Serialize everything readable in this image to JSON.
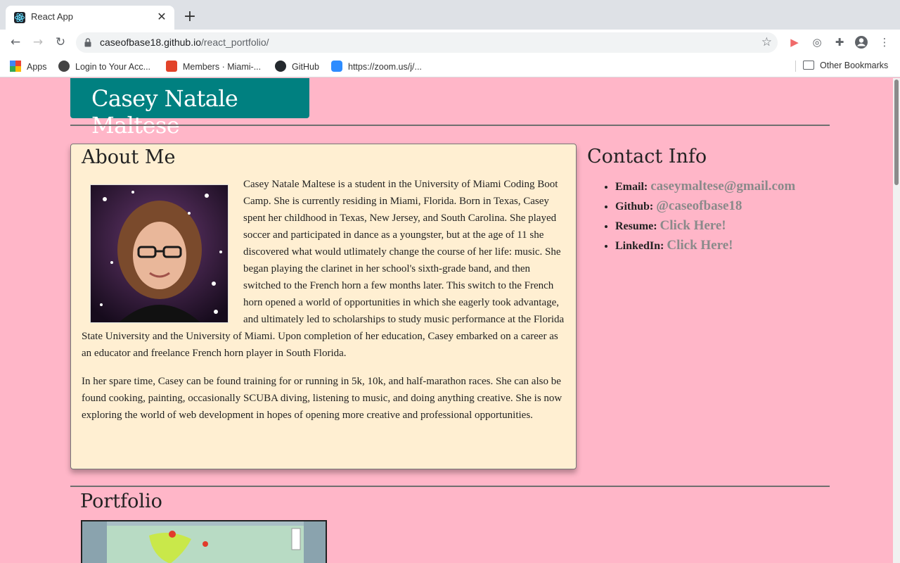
{
  "browser": {
    "tab_title": "React App",
    "tab_close": "✕",
    "new_tab": "+",
    "url_host": "caseofbase18.github.io",
    "url_path": "/react_portfolio/",
    "nav": {
      "back": "←",
      "forward": "→",
      "reload": "↻"
    },
    "star": "☆",
    "bookmarks": [
      {
        "label": "Apps"
      },
      {
        "label": "Login to Your Acc..."
      },
      {
        "label": "Members · Miami-..."
      },
      {
        "label": "GitHub"
      },
      {
        "label": "https://zoom.us/j/..."
      }
    ],
    "other_bookmarks": "Other Bookmarks",
    "colors": {
      "tabstrip": "#dee1e6",
      "omnibox": "#f1f3f4"
    }
  },
  "page": {
    "name": "Casey Natale Maltese",
    "about": {
      "title": "About Me",
      "paragraph1": "Casey Natale Maltese is a student in the University of Miami Coding Boot Camp. She is currently residing in Miami, Florida. Born in Texas, Casey spent her childhood in Texas, New Jersey, and South Carolina. She played soccer and participated in dance as a youngster, but at the age of 11 she discovered what would utlimately change the course of her life: music. She began playing the clarinet in her school's sixth-grade band, and then switched to the French horn a few months later. This switch to the French horn opened a world of opportunities in which she eagerly took advantage, and ultimately led to scholarships to study music performance at the Florida State University and the University of Miami. Upon completion of her education, Casey embarked on a career as an educator and freelance French horn player in South Florida.",
      "paragraph2": "In her spare time, Casey can be found training for or running in 5k, 10k, and half-marathon races. She can also be found cooking, painting, occasionally SCUBA diving, listening to music, and doing anything creative. She is now exploring the world of web development in hopes of opening more creative and professional opportunities."
    },
    "contact": {
      "title": "Contact Info",
      "items": [
        {
          "label": "Email:",
          "value": "caseymaltese@gmail.com"
        },
        {
          "label": "Github:",
          "value": "@caseofbase18"
        },
        {
          "label": "Resume:",
          "value": "Click Here!"
        },
        {
          "label": "LinkedIn:",
          "value": "Click Here!"
        }
      ]
    },
    "portfolio": {
      "title": "Portfolio"
    },
    "colors": {
      "background": "#ffb6c8",
      "header": "#008080",
      "card": "#ffefd2",
      "link": "#8a8a8a"
    }
  }
}
